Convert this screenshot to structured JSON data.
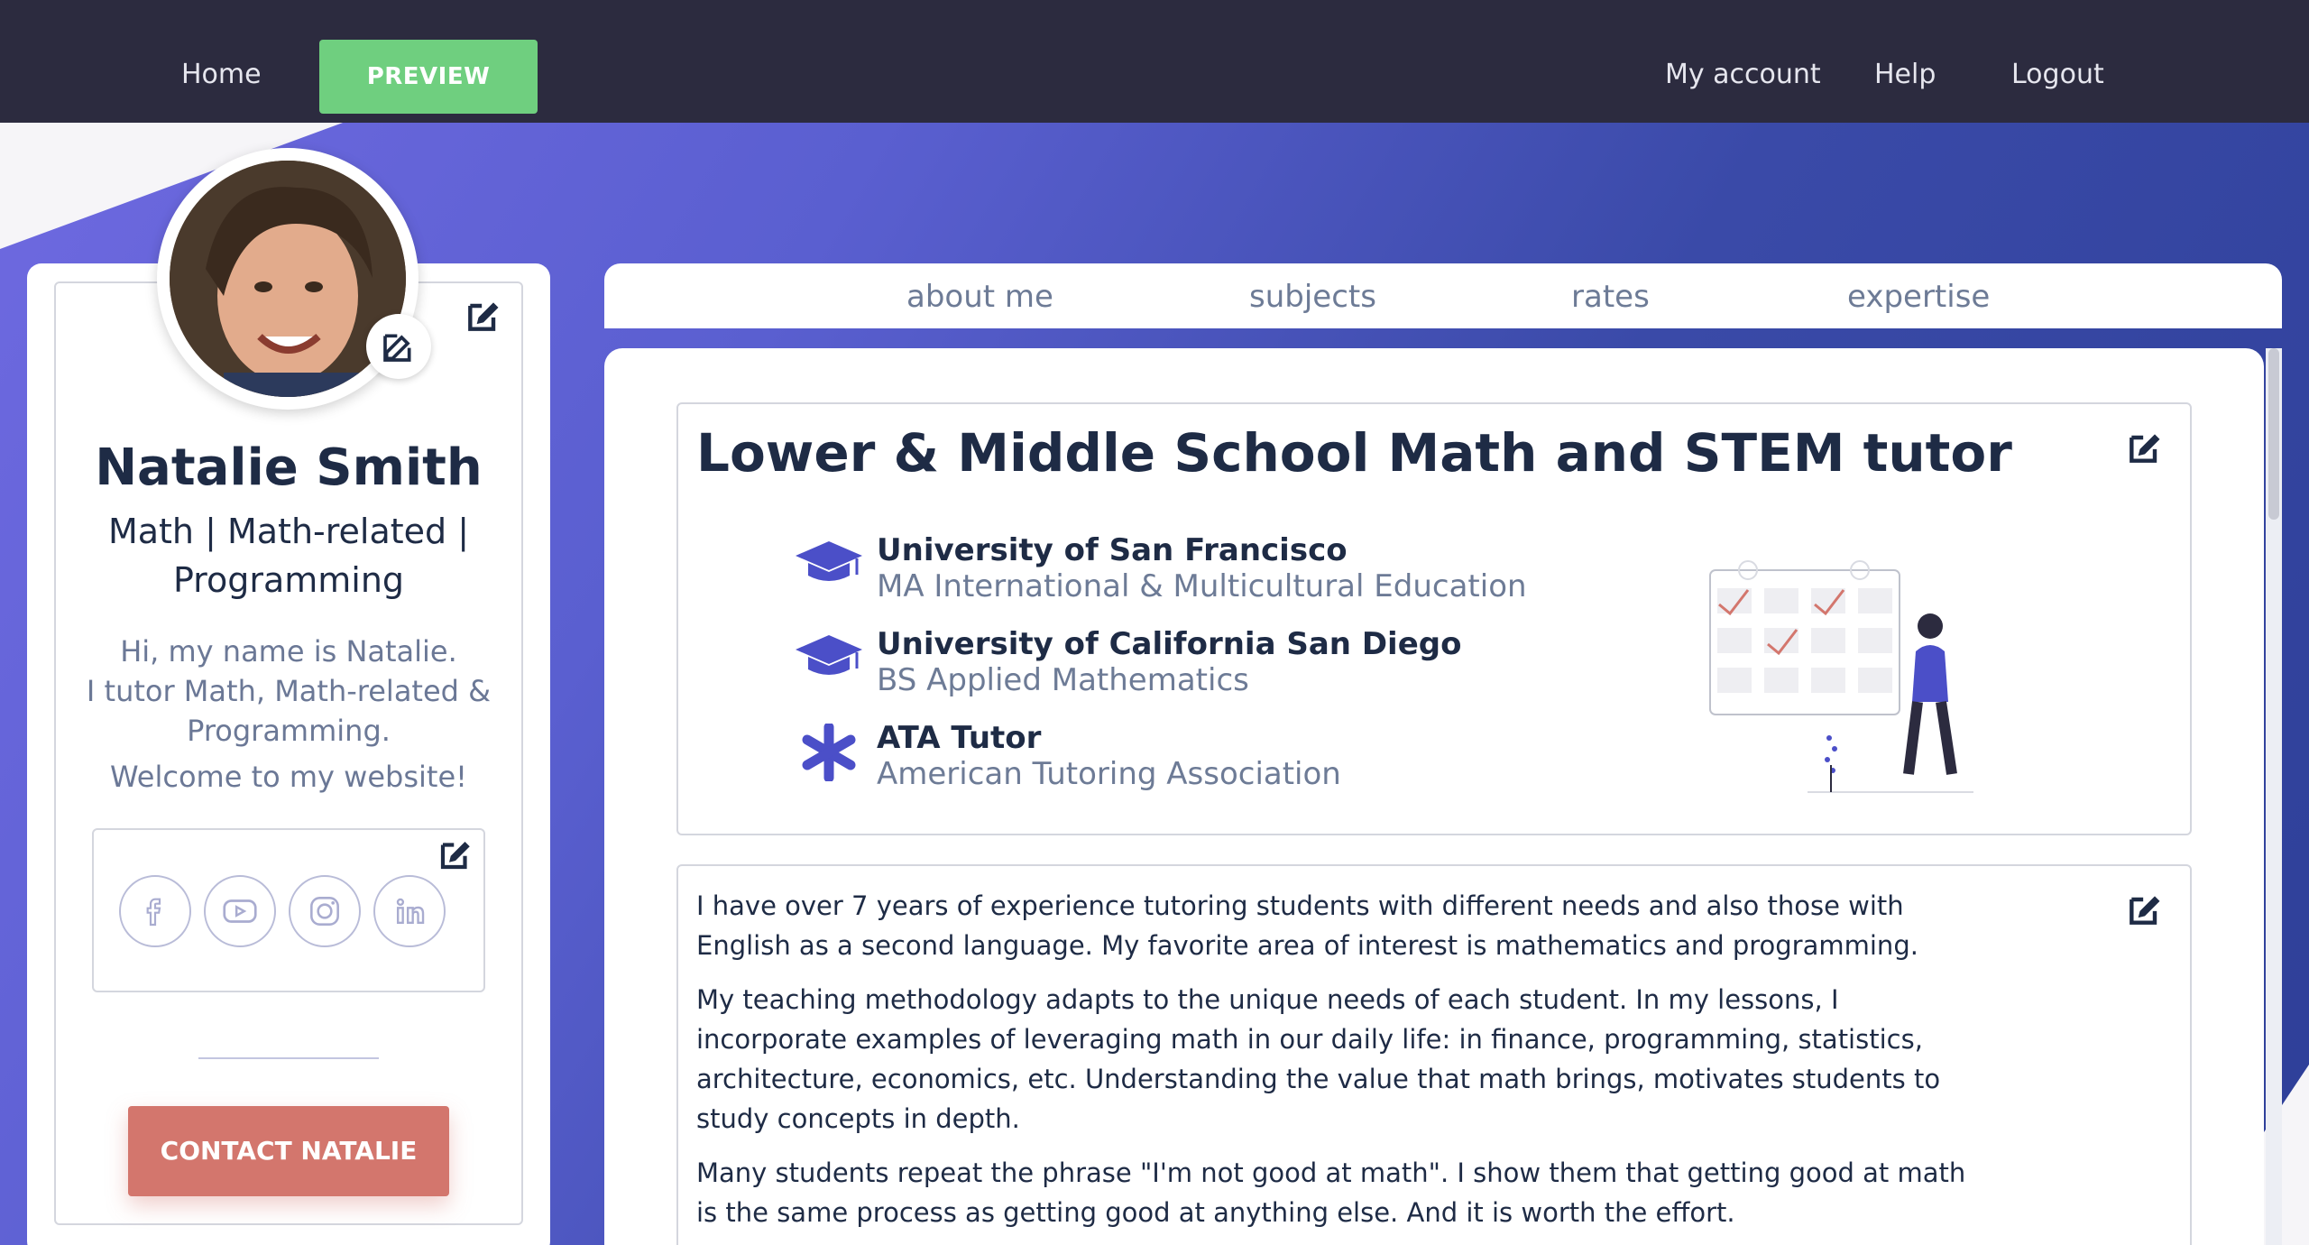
{
  "nav": {
    "home": "Home",
    "preview": "PREVIEW",
    "my_account": "My account",
    "help": "Help",
    "logout": "Logout"
  },
  "profile": {
    "name": "Natalie Smith",
    "tagline": "Math | Math-related | Programming",
    "bio_line1": "Hi, my name is Natalie.",
    "bio_line2": "I tutor Math, Math-related & Programming.",
    "welcome": "Welcome to my website!",
    "contact_label": "CONTACT NATALIE",
    "social_icons": [
      "facebook-icon",
      "youtube-icon",
      "instagram-icon",
      "linkedin-icon"
    ]
  },
  "tabs": {
    "about": "about me",
    "subjects": "subjects",
    "rates": "rates",
    "expertise": "expertise"
  },
  "headline": {
    "title": "Lower & Middle School Math and STEM tutor"
  },
  "credentials": [
    {
      "icon": "graduation-cap-icon",
      "title": "University of San Francisco",
      "subtitle": "MA International & Multicultural Education"
    },
    {
      "icon": "graduation-cap-icon",
      "title": "University of California San Diego",
      "subtitle": "BS Applied Mathematics"
    },
    {
      "icon": "asterisk-icon",
      "title": "ATA Tutor",
      "subtitle": "American Tutoring Association"
    }
  ],
  "bio": {
    "p1": "I have over 7 years of experience tutoring students with different needs and also those with English as a second language. My favorite area of interest is mathematics and programming.",
    "p2": "My teaching methodology adapts to the unique needs of each student. In my lessons, I incorporate examples of leveraging math in our daily life: in finance, programming, statistics, architecture, economics, etc. Understanding the value that math brings, motivates students to study concepts in depth.",
    "p3": "Many students repeat the phrase \"I'm not good at math\". I show them that getting good at math is the same process as getting good at anything else. And it is worth the effort."
  },
  "colors": {
    "nav_bg": "#2c2b3f",
    "preview_green": "#6fcf7f",
    "contact_red": "#d3766d",
    "primary_text": "#1e2b45",
    "muted_text": "#6d7b96",
    "accent_purple": "#4b4fc8"
  }
}
